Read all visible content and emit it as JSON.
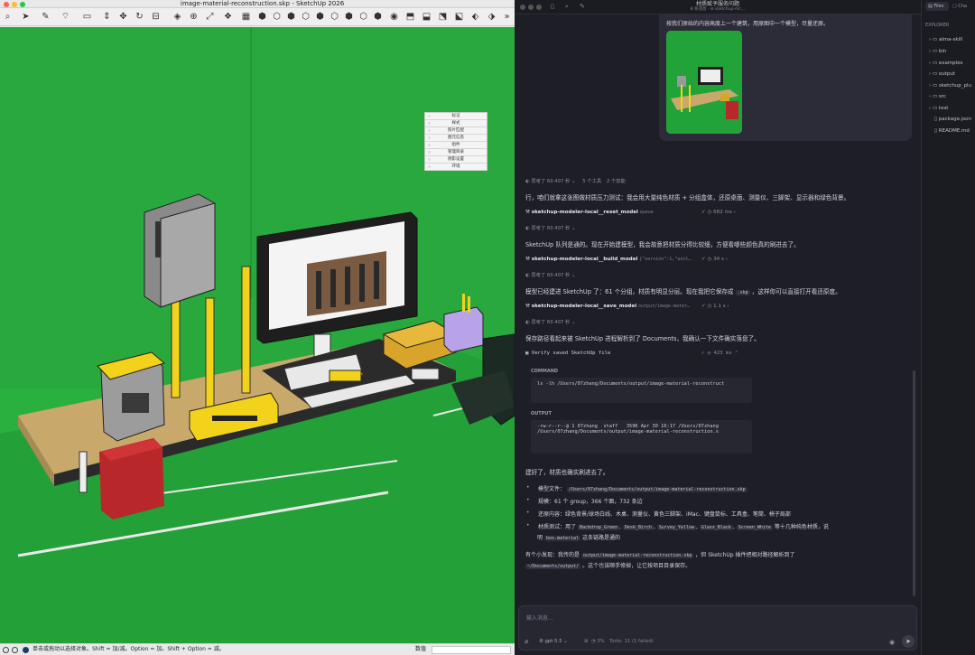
{
  "sketchup": {
    "window_title": "image-material-reconstruction.skp - SketchUp 2026",
    "status_text": "单击或拖动以选择对象。Shift = 加/减。Option = 加。Shift + Option = 减。",
    "measurement_label": "数值",
    "tray_items": [
      "标记",
      "样式",
      "照片匹配",
      "图元信息",
      "组件",
      "管理目录",
      "阴影设置",
      "环境"
    ],
    "toolbar_overflow": "»"
  },
  "chat": {
    "title": "材质赋予服务问题",
    "subtitle": "8 条消息 · ⊖ sketchup-mc…",
    "user_message": "按我们原始的内容高度上一个建筑，用原图中一个模型，尽量还原。",
    "thinking": "思考了 60.407 秒",
    "tools_count": "5 个工具",
    "skills_count": "2 个技能",
    "paragraph1": "行，咱们就拿这张图做材质压力测试：我会用大量纯色材质 + 分组盒体，还原桌面、测量仪、三脚架、显示器和绿色背景。",
    "tool1": {
      "name": "sketchup-modeler-local__reset_model",
      "arg": "queue",
      "time": "682 ms"
    },
    "paragraph2": "SketchUp 队列是通的。现在开始建模型，我会故意把材质分得比较细，方便看哪些颜色真的刷进去了。",
    "tool2": {
      "name": "sketchup-modeler-local__build_model",
      "arg": "{\"version\":1,\"unit…",
      "time": "34 s"
    },
    "paragraph3": "模型已经建进 SketchUp 了：61 个分组，材质有明显分层。现在我把它保存成",
    "paragraph3_code": ".skp",
    "paragraph3_tail": "，这样你可以直接打开看还原度。",
    "tool3": {
      "name": "sketchup-modeler-local__save_model",
      "arg": "output/image-mater…",
      "time": "1.1 s"
    },
    "paragraph4": "保存路径看起来被 SketchUp 进程解析到了 Documents，我确认一下文件确实落盘了。",
    "verify_label": "Verify saved SketchUp file",
    "verify_time": "423 ms",
    "command_label": "COMMAND",
    "command": "ls -lh /Users/07zhang/Documents/output/image-material-reconstruct",
    "output_label": "OUTPUT",
    "output_line1": "-rw-r--r--@ 1 07zhang  staff   359K Apr 30 16:17 /Users/07zhang",
    "output_line2": "/Users/07zhang/Documents/output/image-material-reconstruction.s",
    "done_text": "建好了，材质也确实刷进去了。",
    "bullet1_label": "模型文件：",
    "bullet1_code": "/Users/07zhang/Documents/output/image-material-reconstruction.skp",
    "bullet2": "规模：61 个 group，366 个面，732 条边",
    "bullet3": "还原内容：绿色背景/球场白线、木桌、测量仪、黄色三脚架、iMac、键盘鼠标、工具盒、笔筒、椅子局部",
    "bullet4_pre": "材质测试：用了",
    "bullet4_codes": [
      "Backdrop_Green",
      "Desk_Birch",
      "Survey_Yellow",
      "Glass_Black",
      "Screen_White"
    ],
    "bullet4_tail": "等十几种纯色材质，说",
    "bullet4_line2_pre": "明",
    "bullet4_line2_code": "box.material",
    "bullet4_line2_tail": "这条链路是通的",
    "note_pre": "有个小发现：我传的是",
    "note_code": "output/image-material-reconstruction.skp",
    "note_mid": "，但 SketchUp 插件把相对路径解析到了",
    "note_code2": "~/Documents/output/",
    "note_tail": "。这个也该顺手修掉，让它按项目目录保存。",
    "input_placeholder": "输入消息…",
    "model": "gpt-5.5",
    "context": "3%",
    "tools_status": "Tools: 11 (1 failed)"
  },
  "explorer": {
    "tab_files": "Files",
    "tab_chat": "Cha",
    "header": "EXPLORER",
    "folders": [
      "alma-skill",
      "bin",
      "examples",
      "output",
      "sketchup_plu",
      "src",
      "test"
    ],
    "files": [
      "package.json",
      "README.md"
    ]
  },
  "colors": {
    "green": "#22a33a",
    "yellow": "#f2d21a",
    "accent": "#5ac26a"
  }
}
